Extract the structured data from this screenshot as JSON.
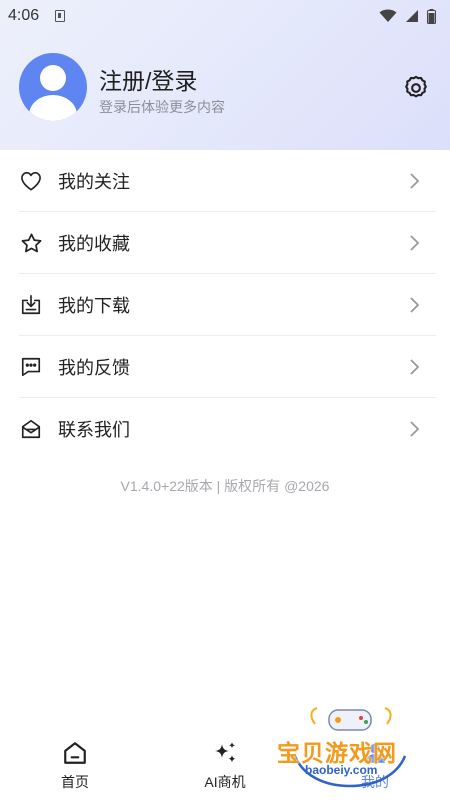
{
  "status": {
    "time": "4:06"
  },
  "profile": {
    "title": "注册/登录",
    "subtitle": "登录后体验更多内容"
  },
  "menu": [
    {
      "icon": "heart-icon",
      "label": "我的关注"
    },
    {
      "icon": "star-icon",
      "label": "我的收藏"
    },
    {
      "icon": "download-icon",
      "label": "我的下载"
    },
    {
      "icon": "feedback-icon",
      "label": "我的反馈"
    },
    {
      "icon": "mail-open-icon",
      "label": "联系我们"
    }
  ],
  "footer": {
    "version": "V1.4.0+22版本 | 版权所有 @2026"
  },
  "tabs": [
    {
      "icon": "home-icon",
      "label": "首页"
    },
    {
      "icon": "sparkle-icon",
      "label": "AI商机"
    },
    {
      "icon": "user-icon",
      "label": "我的"
    }
  ],
  "active_tab": "我的",
  "colors": {
    "accent": "#5f86f0",
    "header_bg": "#e4e8fb",
    "watermark_orange": "#f29a1a",
    "watermark_blue": "#2e63c9"
  },
  "watermark": {
    "text": "宝贝游戏网",
    "url": "baobeiy.com"
  }
}
